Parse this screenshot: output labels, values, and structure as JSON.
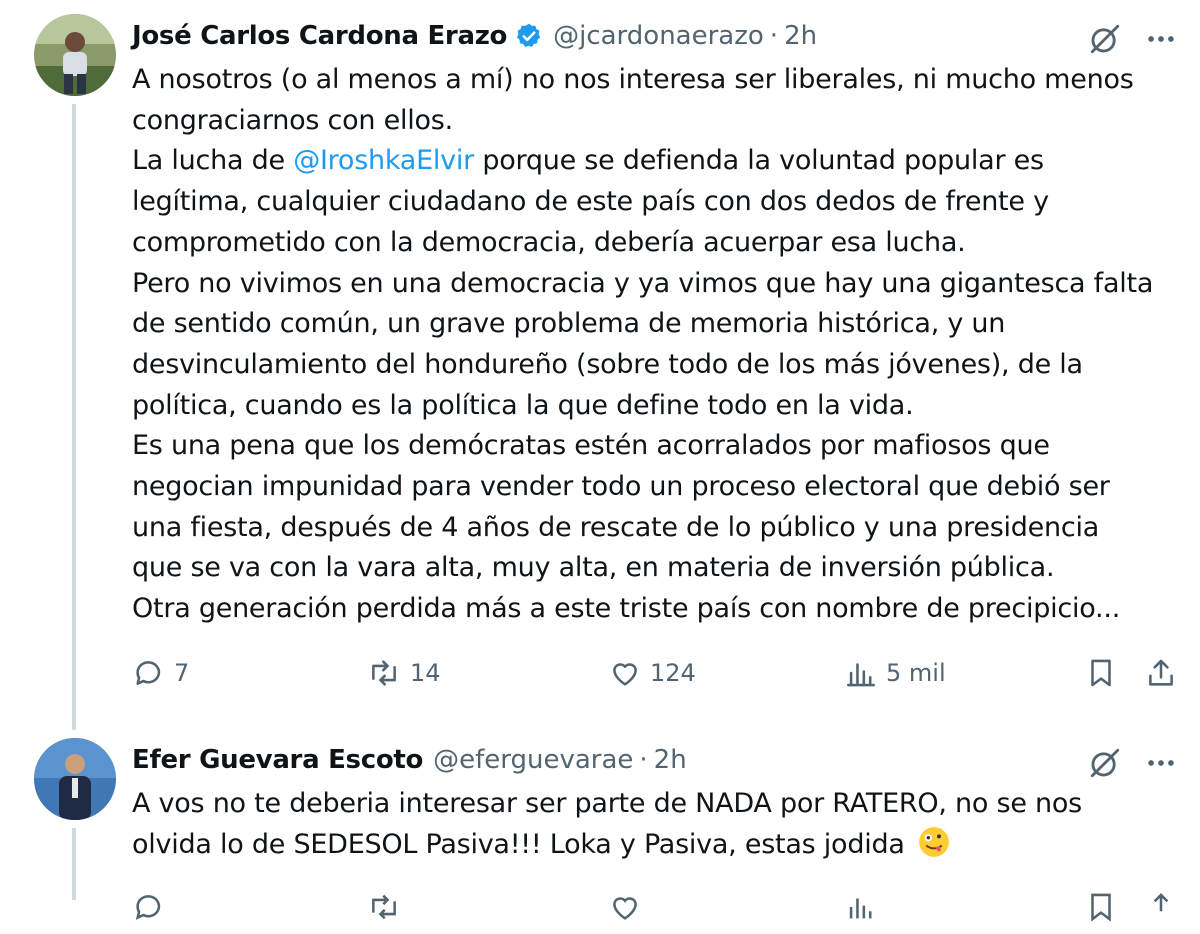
{
  "tweet1": {
    "name": "José Carlos Cardona Erazo",
    "handle": "@jcardonaerazo",
    "separator": "·",
    "time": "2h",
    "lines": [
      "A nosotros (o al menos a mí) no nos interesa ser liberales, ni mucho menos",
      "congraciarnos con ellos.",
      "La lucha de ",
      "legítima, cualquier ciudadano de este país con dos dedos de frente y",
      "comprometido con la democracia, debería acuerpar esa lucha.",
      "Pero no vivimos en una democracia y ya vimos que hay una gigantesca falta",
      "de sentido común, un grave problema de memoria histórica, y un",
      "desvinculamiento del hondureño (sobre todo de los más jóvenes), de la",
      "política, cuando es la política la que define todo en la vida.",
      "Es una pena que los demócratas estén acorralados por mafiosos que",
      "negocian impunidad para vender todo un proceso electoral que debió ser",
      "una fiesta, después de 4 años de rescate de lo público y una presidencia",
      "que se va con la vara alta, muy alta, en materia de inversión pública.",
      "Otra generación perdida más a este triste país con nombre de precipicio..."
    ],
    "mention": "@IroshkaElvir",
    "line3_rest": " porque se defienda la voluntad popular es",
    "replies": "7",
    "reposts": "14",
    "likes": "124",
    "views": "5 mil"
  },
  "tweet2": {
    "name": "Efer Guevara Escoto",
    "handle": "@eferguevarae",
    "separator": "·",
    "time": "2h",
    "lines": [
      "A vos no te deberia interesar ser parte de NADA por RATERO, no se nos",
      "olvida lo de SEDESOL Pasiva!!! Loka y Pasiva, estas jodida "
    ]
  },
  "icons": {
    "verified": "verified-badge-icon",
    "grok": "grok-icon",
    "more": "more-icon",
    "reply": "reply-icon",
    "repost": "repost-icon",
    "like": "like-icon",
    "views": "views-icon",
    "bookmark": "bookmark-icon",
    "share": "share-icon",
    "emoji": "zany-face-emoji-icon"
  },
  "colors": {
    "text": "#0f1419",
    "secondary": "#536471",
    "link": "#1d9bf0",
    "thread": "#cfd9de"
  }
}
